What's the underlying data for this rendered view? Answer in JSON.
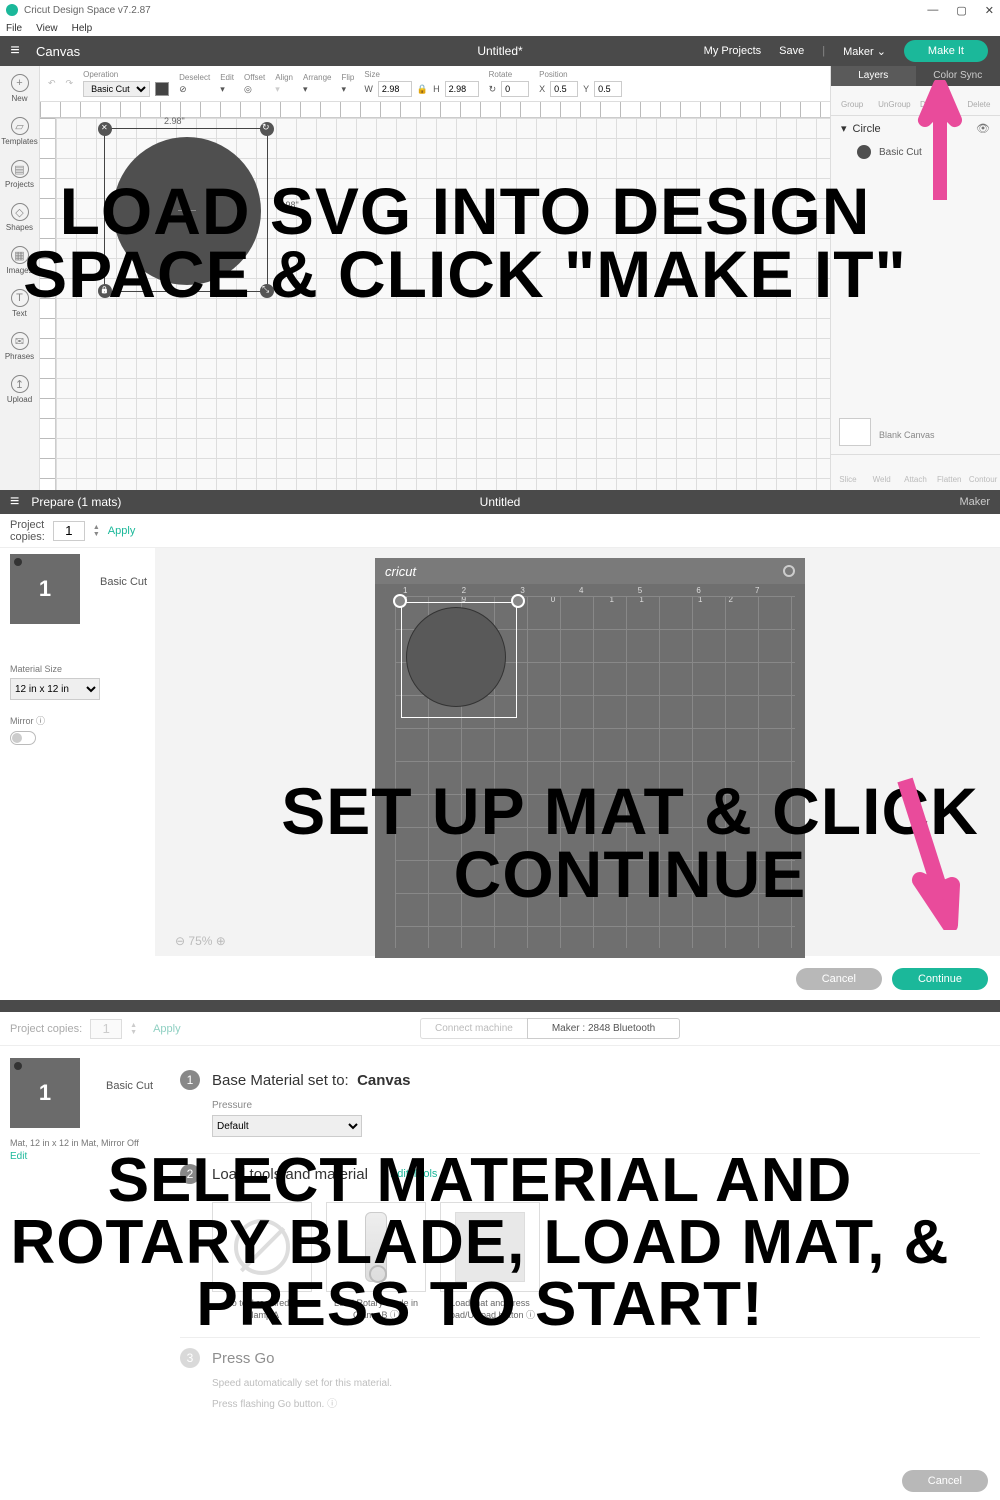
{
  "app": {
    "title": "Cricut Design Space v7.2.87",
    "menu": [
      "File",
      "View",
      "Help"
    ]
  },
  "window_controls": {
    "min": "—",
    "max": "▢",
    "close": "✕"
  },
  "topbar": {
    "canvas": "Canvas",
    "title": "Untitled*",
    "myprojects": "My Projects",
    "save": "Save",
    "machine": "Maker",
    "makeit": "Make It"
  },
  "leftnav": [
    {
      "icon": "+",
      "label": "New"
    },
    {
      "icon": "▱",
      "label": "Templates"
    },
    {
      "icon": "▤",
      "label": "Projects"
    },
    {
      "icon": "◇",
      "label": "Shapes"
    },
    {
      "icon": "▦",
      "label": "Images"
    },
    {
      "icon": "T",
      "label": "Text"
    },
    {
      "icon": "✉",
      "label": "Phrases"
    },
    {
      "icon": "↥",
      "label": "Upload"
    }
  ],
  "propbar": {
    "operation_label": "Operation",
    "operation": "Basic Cut",
    "deselect": "Deselect",
    "edit": "Edit",
    "offset": "Offset",
    "align": "Align",
    "arrange": "Arrange",
    "flip": "Flip",
    "size_label": "Size",
    "w_lbl": "W",
    "w": "2.98",
    "h_lbl": "H",
    "h": "2.98",
    "rotate_label": "Rotate",
    "rotate": "0",
    "position_label": "Position",
    "x_lbl": "X",
    "x": "0.5",
    "y_lbl": "Y",
    "y": "0.5"
  },
  "dims": {
    "w": "2.98\"",
    "h": "2.98\""
  },
  "rpanel": {
    "tabs": {
      "layers": "Layers",
      "color": "Color Sync"
    },
    "tools": {
      "group": "Group",
      "ungroup": "UnGroup",
      "dup": "Duplicate",
      "del": "Delete"
    },
    "layer": "Circle",
    "sublayer": "Basic Cut",
    "blank": "Blank Canvas",
    "btm": {
      "slice": "Slice",
      "weld": "Weld",
      "attach": "Attach",
      "flatten": "Flatten",
      "contour": "Contour"
    }
  },
  "overlay1": "LOAD SVG INTO DESIGN SPACE & CLICK \"MAKE IT\"",
  "prepare": {
    "title": "Prepare (1 mats)",
    "untitled": "Untitled",
    "maker": "Maker",
    "copies_label": "Project copies:",
    "copies": "1",
    "apply": "Apply",
    "matnum": "1",
    "basiccut": "Basic Cut",
    "matsize_label": "Material Size",
    "matsize": "12 in x 12 in",
    "mirror_label": "Mirror",
    "info": "ⓘ",
    "brand": "cricut",
    "ruler": "1 2 3 4 5 6 7 8 9 10 11 12",
    "zoom": "⊖ 75% ⊕",
    "cancel": "Cancel",
    "continue": "Continue"
  },
  "overlay2": "SET UP MAT & CLICK CONTINUE",
  "make": {
    "copies_label": "Project copies:",
    "copies": "1",
    "apply": "Apply",
    "connect": "Connect machine",
    "device": "Maker : 2848 Bluetooth",
    "matnum": "1",
    "basiccut": "Basic Cut",
    "matdesc": "Mat, 12 in x 12 in Mat, Mirror Off",
    "edit": "Edit",
    "step1": "Base Material set to:",
    "step1b": "Canvas",
    "pressure_label": "Pressure",
    "pressure": "Default",
    "step2": "Load tools and material",
    "edittools": "Edit Tools",
    "card1": "No tool required in Clamp A",
    "card2": "Load Rotary Blade in Clamp B ⓘ",
    "card3": "Load mat and press Load/Unload button ⓘ",
    "step3": "Press Go",
    "step3a": "Speed automatically set for this material.",
    "step3b": "Press flashing Go button. ⓘ",
    "cancel": "Cancel"
  },
  "overlay3": "SELECT MATERIAL AND ROTARY BLADE, LOAD MAT, & PRESS TO START!"
}
